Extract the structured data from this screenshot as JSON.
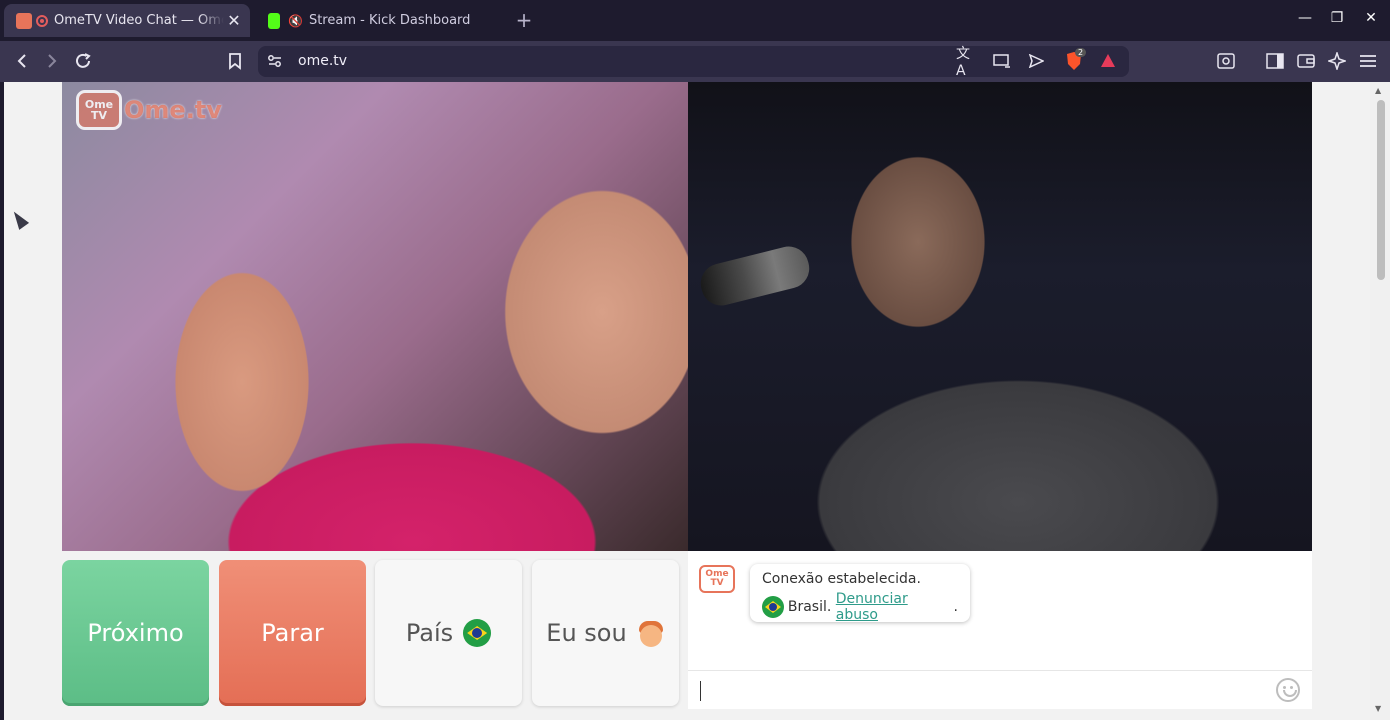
{
  "browser": {
    "tabs": [
      {
        "title": "OmeTV Video Chat — Omegle",
        "active": true,
        "close": "✕"
      },
      {
        "title": "Stream - Kick Dashboard",
        "active": false,
        "muted": true
      }
    ],
    "new_tab": "+",
    "window_controls": [
      "—",
      "❐",
      "✕"
    ],
    "url": "ome.tv",
    "brave_shield_count": "2"
  },
  "page": {
    "logo_tv": "Ome\nTV",
    "logo_wordmark": "Ome.tv",
    "buttons": {
      "next": "Próximo",
      "stop": "Parar",
      "country": "País",
      "gender": "Eu sou"
    },
    "chat": {
      "logo": "Ome\nTV",
      "status": "Conexão estabelecida.",
      "country": "Brasil.",
      "report_link": "Denunciar abuso",
      "period": "."
    }
  }
}
